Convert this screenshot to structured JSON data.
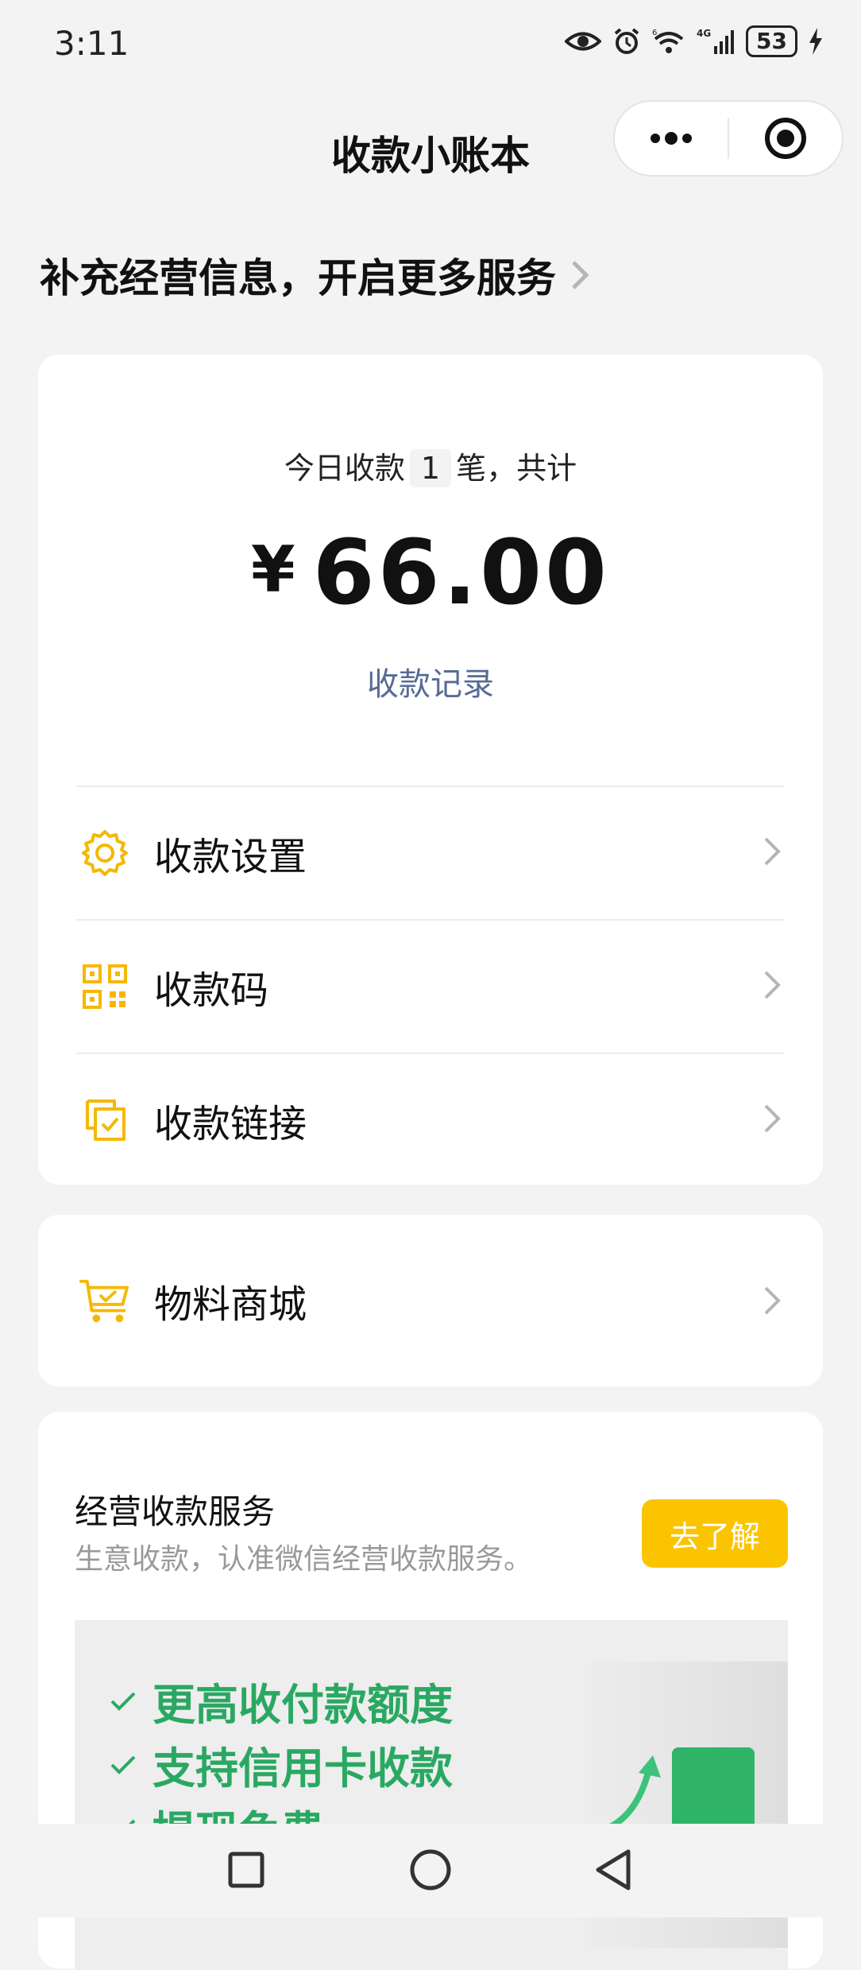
{
  "status_bar": {
    "time": "3:11",
    "network": "4G",
    "wifi_badge": "6",
    "battery": "53"
  },
  "header": {
    "title": "收款小账本",
    "more_icon": "more-dots-icon",
    "close_icon": "target-circle-icon"
  },
  "banner": {
    "text": "补充经营信息，开启更多服务"
  },
  "summary": {
    "prefix": "今日收款",
    "count": "1",
    "suffix": "笔，共计",
    "currency": "¥",
    "amount": "66.00",
    "records_link": "收款记录"
  },
  "menu": [
    {
      "label": "收款设置",
      "icon": "gear-icon"
    },
    {
      "label": "收款码",
      "icon": "qr-code-icon"
    },
    {
      "label": "收款链接",
      "icon": "link-check-icon"
    }
  ],
  "store": {
    "label": "物料商城",
    "icon": "cart-icon"
  },
  "service": {
    "title": "经营收款服务",
    "description": "生意收款，认准微信经营收款服务。",
    "button": "去了解",
    "features": [
      "更高收付款额度",
      "支持信用卡收款",
      "提现免费"
    ]
  },
  "colors": {
    "accent_yellow": "#fbc400",
    "link_blue": "#576b95",
    "feature_green": "#2aa862"
  }
}
